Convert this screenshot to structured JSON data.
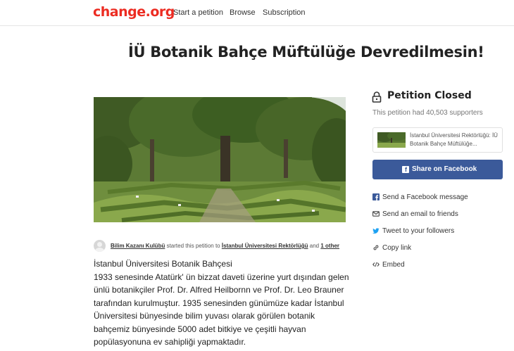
{
  "header": {
    "logo": "change.org",
    "nav": [
      "Start a petition",
      "Browse",
      "Subscription"
    ]
  },
  "petition": {
    "title": "İÜ Botanik Bahçe Müftülüğe Devredilmesin!",
    "starter": {
      "name": "Bilim Kazanı Kulübü",
      "middle": " started this petition to ",
      "target": "İstanbul Üniversitesi Rektörlüğü",
      "and": " and ",
      "other": "1 other"
    },
    "body": [
      "İstanbul Üniversitesi Botanik Bahçesi",
      "1933 senesinde Atatürk' ün bizzat daveti üzerine yurt dışından gelen ünlü botanikçiler Prof. Dr. Alfred Heilbornn ve Prof. Dr. Leo Brauner tarafından kurulmuştur. 1935 senesinden günümüze kadar İstanbul Üniversitesi bünyesinde bilim yuvası olarak görülen botanik bahçemiz bünyesinde 5000 adet bitkiye ve çeşitli hayvan popülasyonuna ev sahipliği yapmaktadır."
    ]
  },
  "sidebar": {
    "status": "Petition Closed",
    "supporters": "This petition had 40,503 supporters",
    "target_card": "İstanbul Üniversitesi Rektörlüğü: İÜ Botanik Bahçe Müftülüğe...",
    "facebook_button": "Share on Facebook",
    "share_options": [
      {
        "icon": "facebook-icon",
        "label": "Send a Facebook message"
      },
      {
        "icon": "email-icon",
        "label": "Send an email to friends"
      },
      {
        "icon": "twitter-icon",
        "label": "Tweet to your followers"
      },
      {
        "icon": "link-icon",
        "label": "Copy link"
      },
      {
        "icon": "embed-icon",
        "label": "Embed"
      }
    ]
  },
  "colors": {
    "brand": "#ec2c22",
    "facebook": "#3b5a9a",
    "twitter": "#1da1f2"
  }
}
